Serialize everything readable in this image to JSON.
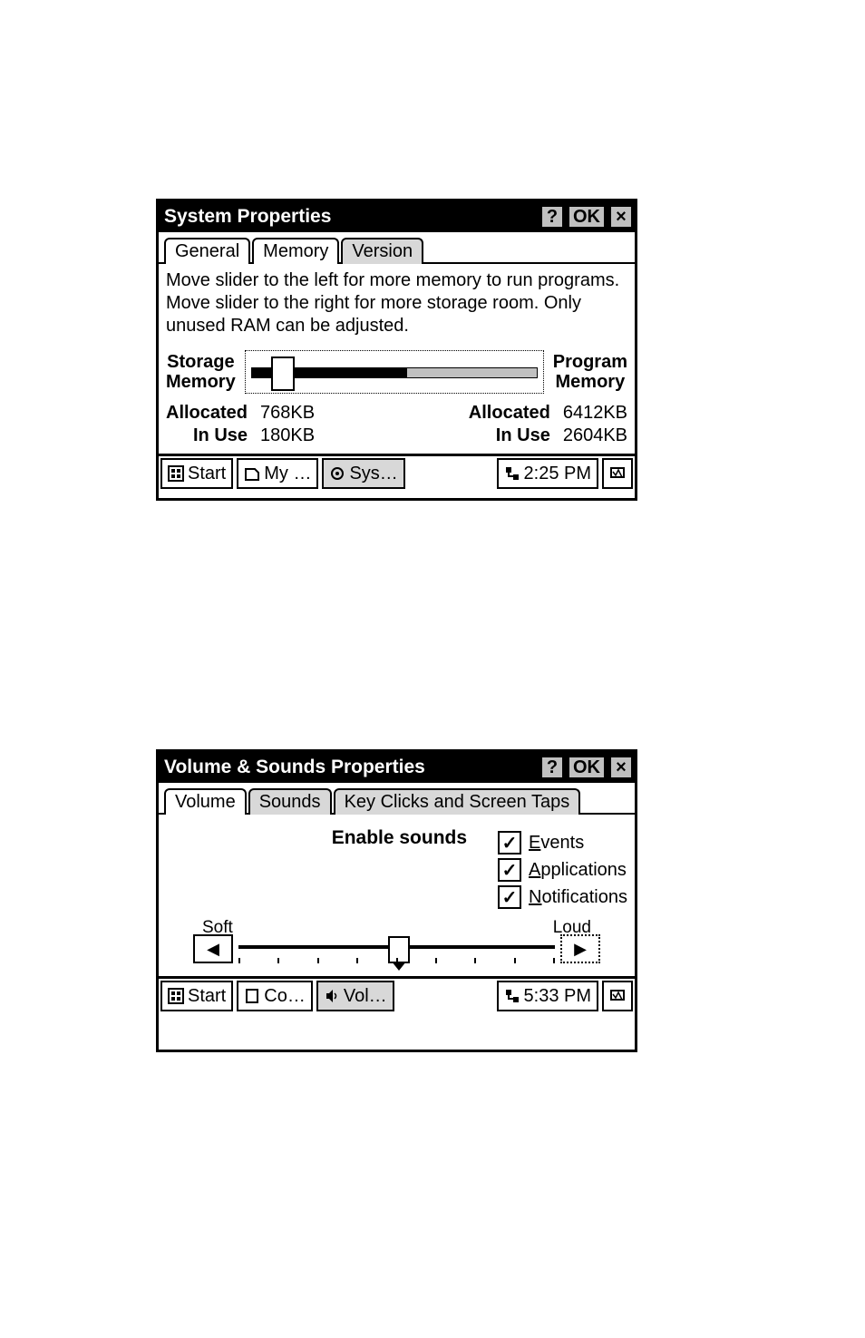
{
  "win1": {
    "title": "System Properties",
    "btn_help": "?",
    "btn_ok": "OK",
    "btn_close": "×",
    "tabs": [
      "General",
      "Memory",
      "Version"
    ],
    "desc": "Move slider to the left for more memory to run programs. Move slider to the right for more storage room. Only unused RAM can be adjusted.",
    "left_label_1": "Storage",
    "left_label_2": "Memory",
    "right_label_1": "Program",
    "right_label_2": "Memory",
    "allocated_label": "Allocated",
    "inuse_label": "In Use",
    "storage_allocated": "768KB",
    "storage_inuse": "180KB",
    "program_allocated": "6412KB",
    "program_inuse": "2604KB",
    "taskbar": {
      "start": "Start",
      "item1": "My …",
      "item2": "Sys…",
      "time": "2:25 PM"
    }
  },
  "win2": {
    "title": "Volume & Sounds Properties",
    "btn_help": "?",
    "btn_ok": "OK",
    "btn_close": "×",
    "tabs": [
      "Volume",
      "Sounds",
      "Key Clicks and Screen Taps"
    ],
    "enable_sounds": "Enable sounds",
    "chk": [
      {
        "u": "E",
        "rest": "vents"
      },
      {
        "u": "A",
        "rest": "pplications"
      },
      {
        "u": "N",
        "rest": "otifications"
      }
    ],
    "soft": "Soft",
    "loud": "Loud",
    "taskbar": {
      "start": "Start",
      "item1": "Co…",
      "item2": "Vol…",
      "time": "5:33 PM"
    }
  }
}
